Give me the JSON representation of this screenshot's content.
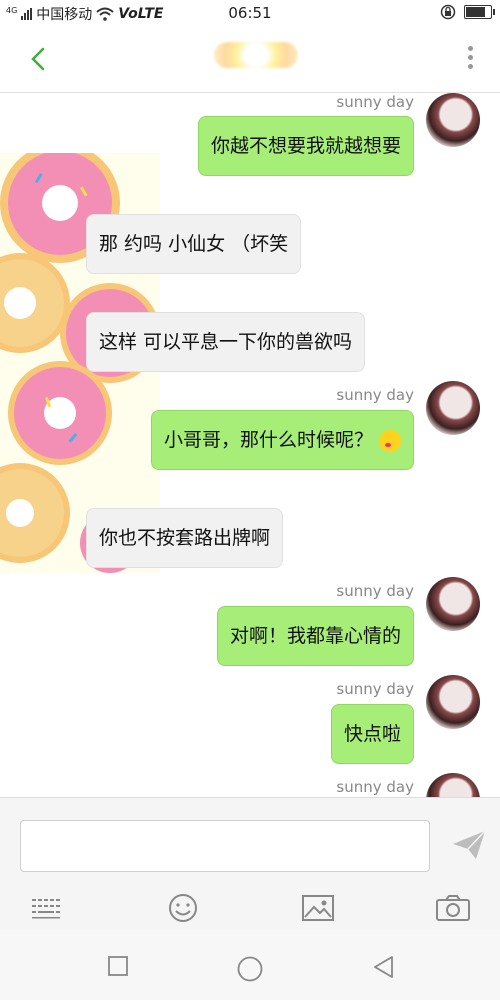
{
  "status_bar": {
    "network_type": "4G",
    "carrier": "中国移动",
    "volte": "VoLTE",
    "time": "06:51",
    "battery_level": 0.85
  },
  "header": {
    "back_icon": "back-chevron-icon",
    "more_icon": "more-vertical-icon",
    "accent_color": "#3cb035"
  },
  "messages": [
    {
      "side": "out",
      "sender": "sunny day",
      "text": "你越不想要我就越想要"
    },
    {
      "side": "in",
      "text": "那 约吗 小仙女 （坏笑"
    },
    {
      "side": "in",
      "text": "这样 可以平息一下你的兽欲吗"
    },
    {
      "side": "out",
      "sender": "sunny day",
      "text": "小哥哥，那什么时候呢？",
      "emoji": "kissing-face-emoji"
    },
    {
      "side": "in",
      "text": "你也不按套路出牌啊"
    },
    {
      "side": "out",
      "sender": "sunny day",
      "text": "对啊！我都靠心情的"
    },
    {
      "side": "out",
      "sender": "sunny day",
      "text": "快点啦"
    },
    {
      "side": "out",
      "sender": "sunny day",
      "text": ""
    }
  ],
  "colors": {
    "outgoing_bubble": "#a7ee79",
    "incoming_bubble": "#f1f1f1"
  },
  "input": {
    "value": "",
    "placeholder": ""
  },
  "toolbar": {
    "icons": [
      "keyboard-icon",
      "emoji-icon",
      "image-icon",
      "camera-icon"
    ],
    "send_icon": "send-icon"
  },
  "nav_bar": {
    "icons": [
      "recent-apps-icon",
      "home-icon",
      "back-icon"
    ]
  }
}
